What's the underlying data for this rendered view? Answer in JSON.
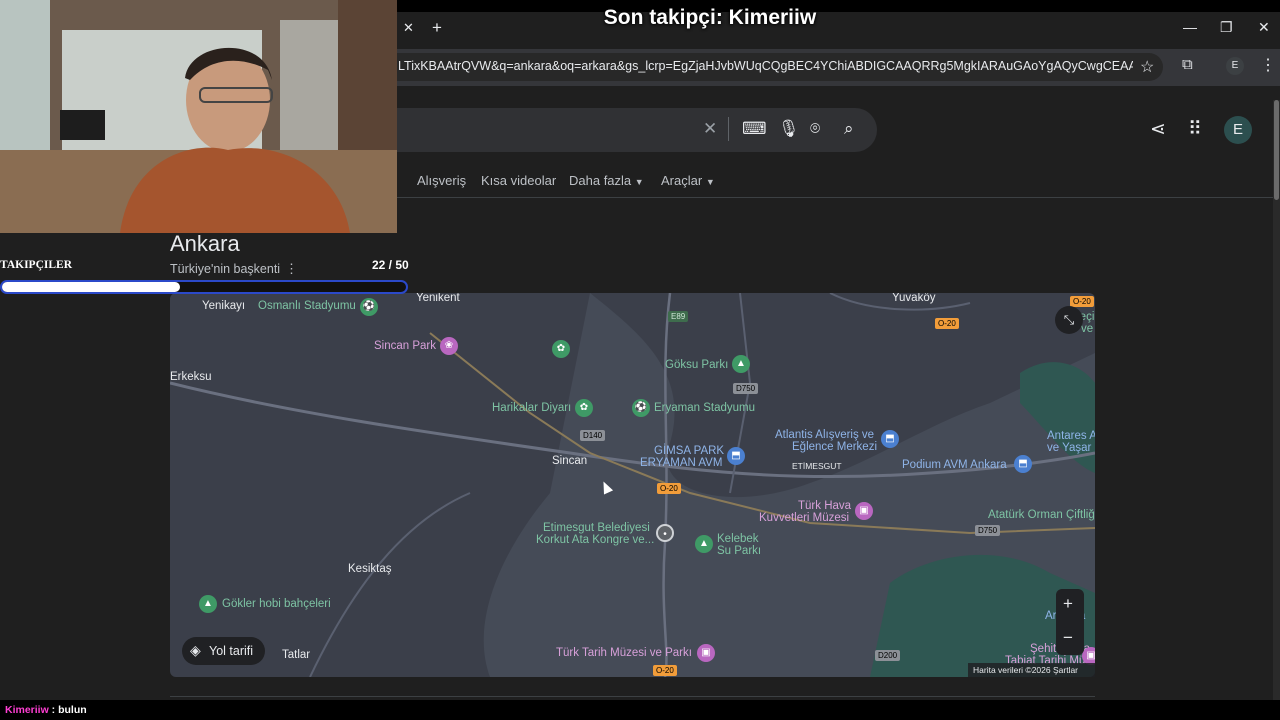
{
  "stream": {
    "latest_follower": "Son takipçi: Kimeriiw",
    "followers_label": "TAKIPÇILER",
    "followers_count": "22 / 50",
    "followers_progress": 0.44,
    "chat_user": "Kimeriiw",
    "chat_message": " : bulun"
  },
  "browser": {
    "url": "LTixKBAAtrQVW&q=ankara&oq=arkara&gs_lcrp=EgZjaHJvbWUqCQgBEC4YChiABDIGCAAQRRg5MgkIARAuGAoYgAQyCwgCEAAYChgLGIAE...",
    "profile_initial": "E"
  },
  "google": {
    "tabs": [
      "Alışveriş",
      "Kısa videolar",
      "Daha fazla",
      "Araçlar"
    ],
    "avatar_initial": "E",
    "knowledge_panel": {
      "title": "Ankara",
      "subtitle": "Türkiye'nin başkenti"
    }
  },
  "map": {
    "labels": {
      "yenikayi": "Yenikayı",
      "osmanli": "Osmanlı Stadyumu",
      "yenikent": "Yenikent",
      "yuvakoy": "Yuvaköy",
      "sincan_park": "Sincan Park",
      "erkeksu": "Erkeksu",
      "goksu": "Göksu Parkı",
      "harikalar": "Harikalar Diyarı",
      "eryaman_stad": "Eryaman Stadyumu",
      "atlantis_1": "Atlantis Alışveriş ve",
      "atlantis_2": "Eğlence Merkezi",
      "antares_1": "Antares A",
      "antares_2": "ve Yaşar",
      "gimsa_1": "GİMSA PARK",
      "gimsa_2": "ERYAMAN AVM",
      "etimesgut": "ETİMESGUT",
      "podium": "Podium AVM Ankara",
      "sincan": "Sincan",
      "turk_hava_1": "Türk Hava",
      "turk_hava_2": "Kuvvetleri Müzesi",
      "ataturk_orman": "Atatürk Orman Çiftliği",
      "belediye_1": "Etimesgut Belediyesi",
      "belediye_2": "Korkut Ata Kongre ve...",
      "kelebek_1": "Kelebek",
      "kelebek_2": "Su Parkı",
      "kesiktas": "Kesiktaş",
      "gokler": "Gökler hobi bahçeleri",
      "armada": "Armada",
      "sehit_cuma": "Şehit Cuma",
      "tabiat": "Tabiat Tarihi Müzesi",
      "tatlar": "Tatlar",
      "turk_tarih": "Türk Tarih Müzesi ve Parkı",
      "right_top": "Seçi",
      "right_top_2": "ve"
    },
    "roads": [
      "E89",
      "D750",
      "D140",
      "O-20",
      "O-20",
      "D750",
      "D200",
      "O-20",
      "O-20"
    ],
    "directions_label": "Yol tarifi",
    "attribution": "Harita verileri ©2026   Şartlar"
  }
}
